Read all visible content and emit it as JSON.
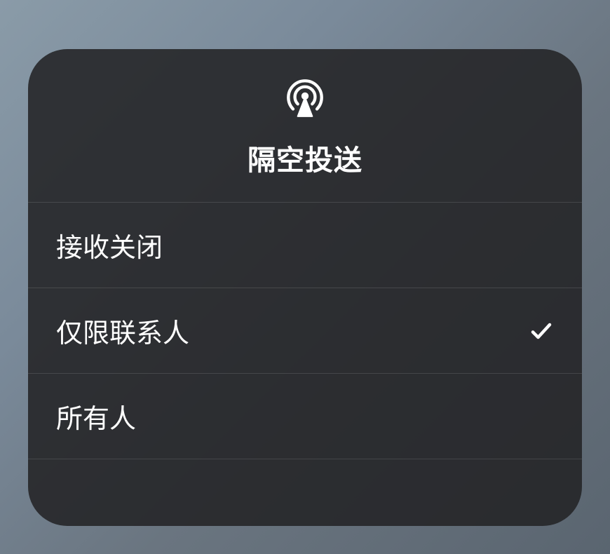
{
  "header": {
    "title": "隔空投送",
    "icon_name": "airdrop-icon"
  },
  "options": [
    {
      "label": "接收关闭",
      "selected": false
    },
    {
      "label": "仅限联系人",
      "selected": true
    },
    {
      "label": "所有人",
      "selected": false
    }
  ]
}
